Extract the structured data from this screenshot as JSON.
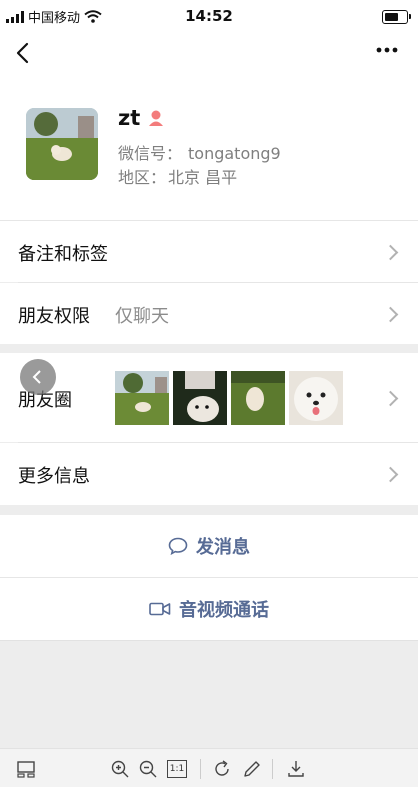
{
  "status_bar": {
    "carrier": "中国移动",
    "time": "14:52"
  },
  "nav": {
    "back_icon": "chevron-left-icon",
    "more_icon": "more-dots-icon"
  },
  "profile": {
    "name": "zt",
    "gender_icon": "female-icon",
    "wechat_id_label": "微信号：",
    "wechat_id": "tongatong9",
    "region_label": "地区：",
    "region": "北京 昌平"
  },
  "rows": {
    "remark_label": "备注和标签",
    "permission_label": "朋友权限",
    "permission_value": "仅聊天",
    "moments_label": "朋友圈",
    "more_info_label": "更多信息"
  },
  "actions": {
    "message_label": "发消息",
    "call_label": "音视频通话"
  },
  "colors": {
    "link": "#576b95",
    "female": "#f37c7c"
  },
  "toolbar": {
    "icons": [
      "panel-icon",
      "zoom-in-icon",
      "zoom-out-icon",
      "actual-size-icon",
      "rotate-icon",
      "pen-icon",
      "download-icon"
    ],
    "actual_size_label": "1:1"
  }
}
